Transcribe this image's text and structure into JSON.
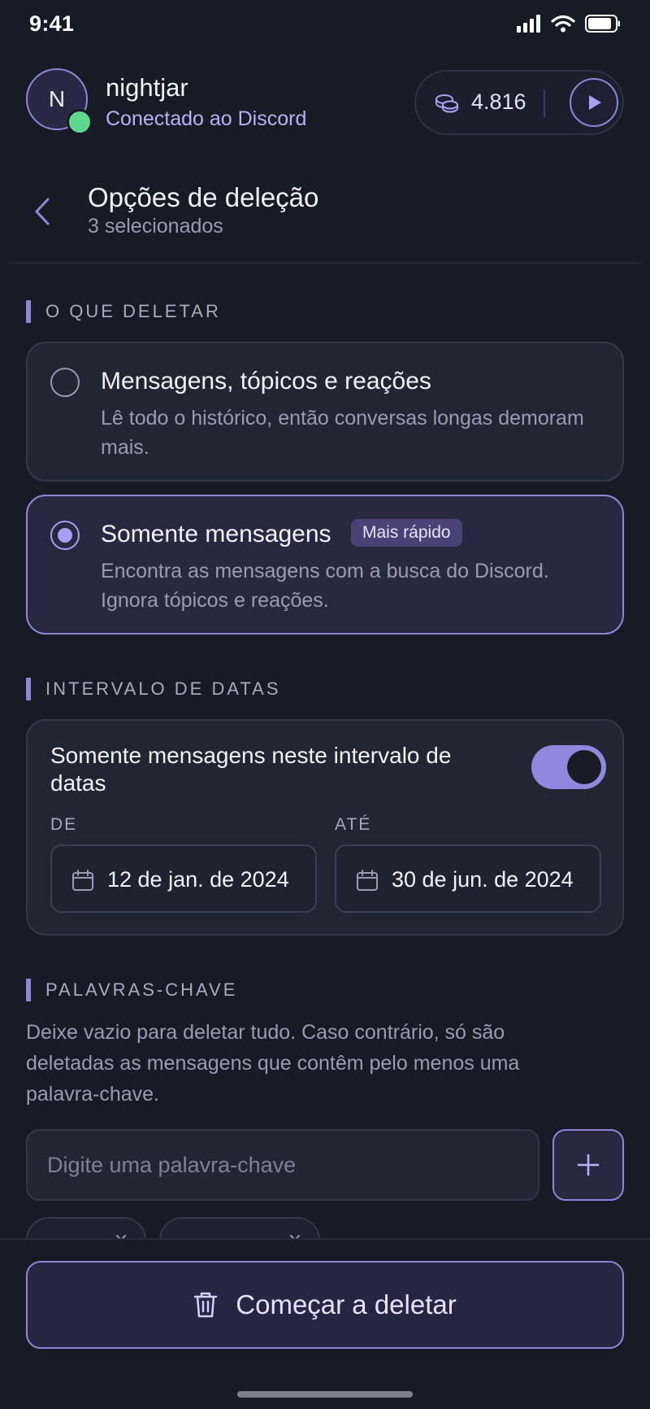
{
  "status_bar": {
    "time": "9:41"
  },
  "user": {
    "avatar_initial": "N",
    "name": "nightjar",
    "status": "Conectado ao Discord",
    "presence_color": "#5fd68e"
  },
  "coins": {
    "icon": "coins-icon",
    "value": "4.816",
    "play_icon": "play-icon"
  },
  "page": {
    "title": "Opções de deleção",
    "subtitle": "3 selecionados",
    "back_icon": "chevron-left-icon"
  },
  "what_to_delete": {
    "section_label": "O QUE DELETAR",
    "options": [
      {
        "title": "Mensagens, tópicos e reações",
        "description": "Lê todo o histórico, então conversas longas demoram mais.",
        "selected": false
      },
      {
        "title": "Somente mensagens",
        "badge": "Mais rápido",
        "description": "Encontra as mensagens com a busca do Discord. Ignora tópicos e reações.",
        "selected": true
      }
    ]
  },
  "date_range": {
    "section_label": "INTERVALO DE DATAS",
    "toggle_label": "Somente mensagens neste intervalo de datas",
    "toggle_on": true,
    "from_label": "DE",
    "from_value": "12 de jan. de 2024",
    "to_label": "ATÉ",
    "to_value": "30 de jun. de 2024"
  },
  "keywords": {
    "section_label": "PALAVRAS-CHAVE",
    "help_text": "Deixe vazio para deletar tudo. Caso contrário, só são deletadas as mensagens que contêm pelo menos uma palavra-chave.",
    "input_placeholder": "Digite uma palavra-chave",
    "input_value": "",
    "add_icon": "plus-icon"
  },
  "footer": {
    "start_button_label": "Começar a deletar",
    "start_icon": "trash-icon"
  },
  "colors": {
    "background": "#181a26",
    "accent": "#8f85d8",
    "card": "#232533",
    "selected_card": "#2a2840",
    "text_muted": "#9a9bb0"
  }
}
